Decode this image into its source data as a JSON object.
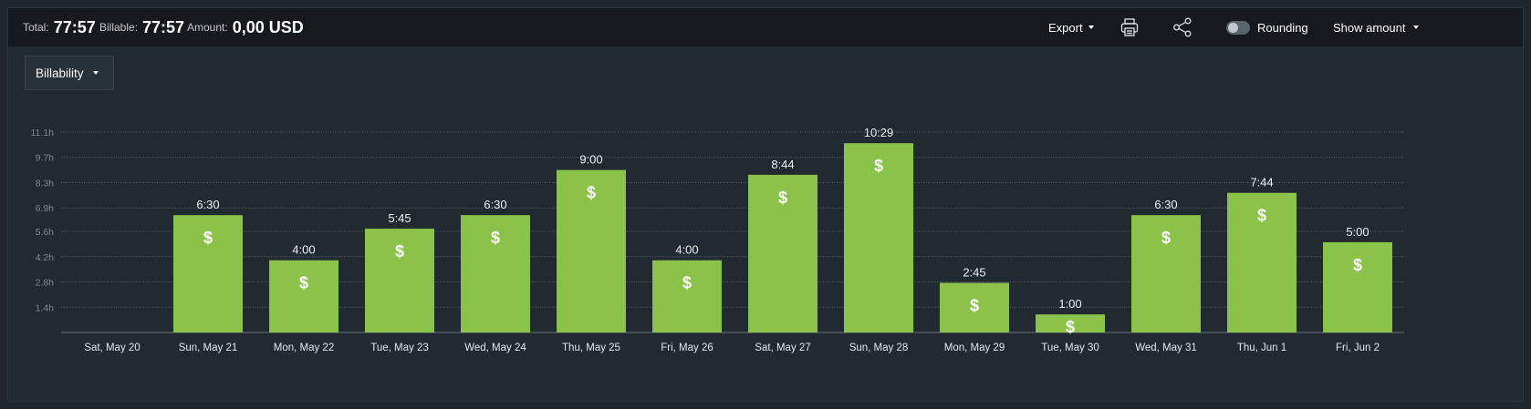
{
  "header": {
    "total_label": "Total:",
    "total_value": "77:57",
    "billable_label": "Billable:",
    "billable_value": "77:57",
    "amount_label": "Amount:",
    "amount_value": "0,00 USD",
    "export_label": "Export",
    "rounding_label": "Rounding",
    "rounding_enabled": false,
    "show_amount_label": "Show amount",
    "print_icon": "printer-icon",
    "share_icon": "share-icon"
  },
  "filter": {
    "label": "Billability"
  },
  "colors": {
    "bar": "#8bc34a",
    "background": "#212a31",
    "topbar": "#141a1e"
  },
  "chart_data": {
    "type": "bar",
    "categories": [
      "Sat, May 20",
      "Sun, May 21",
      "Mon, May 22",
      "Tue, May 23",
      "Wed, May 24",
      "Thu, May 25",
      "Fri, May 26",
      "Sat, May 27",
      "Sun, May 28",
      "Mon, May 29",
      "Tue, May 30",
      "Wed, May 31",
      "Thu, Jun 1",
      "Fri, Jun 2"
    ],
    "values": [
      0,
      6.5,
      4.0,
      5.75,
      6.5,
      9.0,
      4.0,
      8.733,
      10.483,
      2.75,
      1.0,
      6.5,
      7.733,
      5.0
    ],
    "value_labels": [
      "",
      "6:30",
      "4:00",
      "5:45",
      "6:30",
      "9:00",
      "4:00",
      "8:44",
      "10:29",
      "2:45",
      "1:00",
      "6:30",
      "7:44",
      "5:00"
    ],
    "bar_symbol": "$",
    "ylim": [
      0,
      11.1
    ],
    "yticks": [
      1.4,
      2.8,
      4.2,
      5.6,
      6.9,
      8.3,
      9.7,
      11.1
    ],
    "ytick_labels": [
      "1.4h",
      "2.8h",
      "4.2h",
      "5.6h",
      "6.9h",
      "8.3h",
      "9.7h",
      "11.1h"
    ],
    "grid": true,
    "xlabel": "",
    "ylabel": ""
  }
}
